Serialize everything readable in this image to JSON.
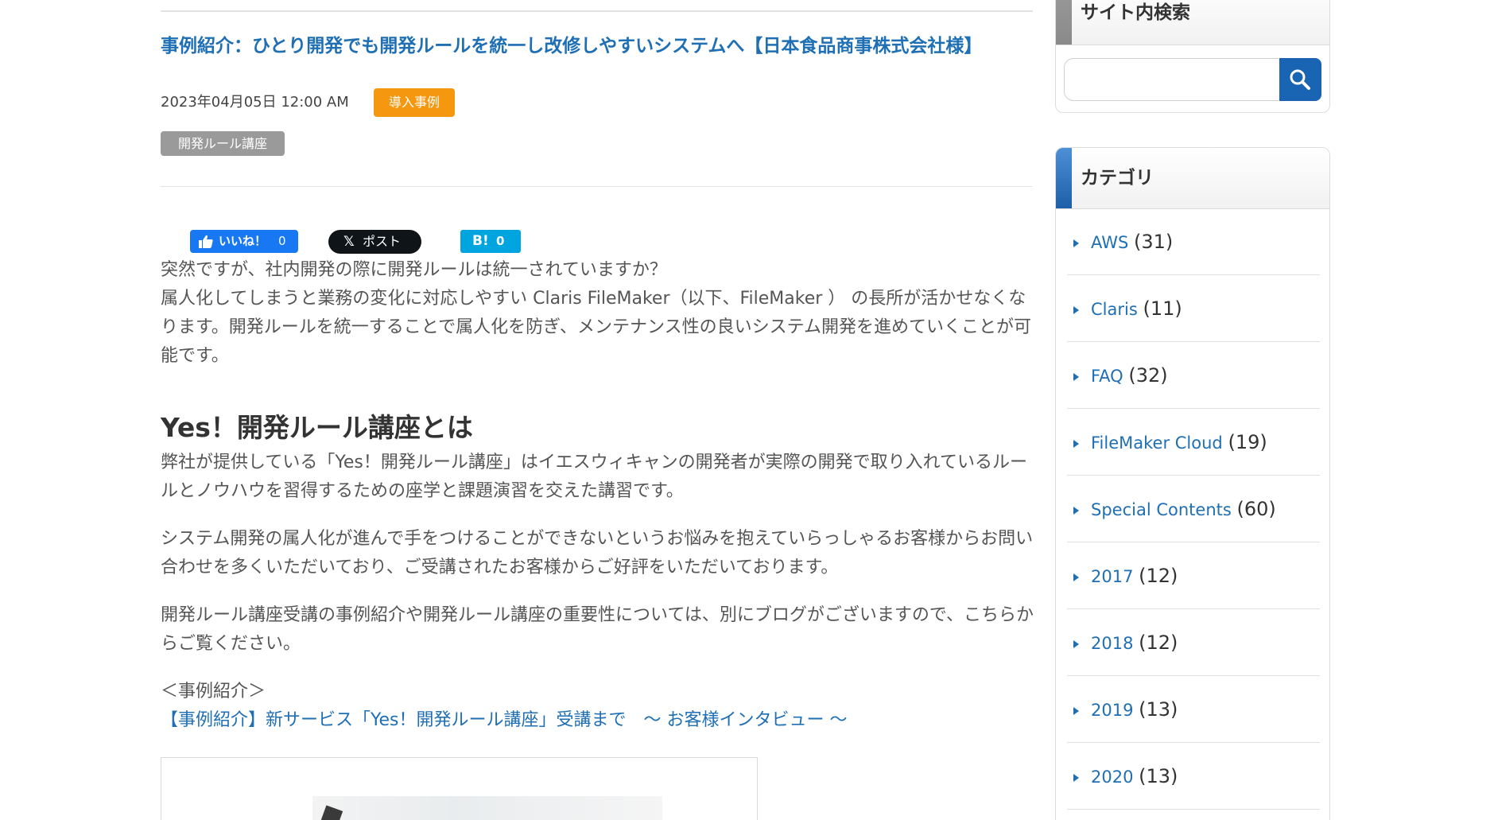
{
  "post": {
    "title": "事例紹介：ひとり開発でも開発ルールを統一し改修しやすいシステムへ【日本食品商事株式会社様】",
    "date": "2023年04月05日 12:00 AM",
    "category": "導入事例",
    "tag": "開発ルール講座"
  },
  "social": {
    "fb_label": "いいね！",
    "fb_count": "0",
    "x_mark": "𝕏",
    "x_label": "ポスト",
    "hatena_mark": "B!",
    "hatena_count": "0"
  },
  "content": {
    "intro_line1": "突然ですが、社内開発の際に開発ルールは統一されていますか？",
    "intro_line2": "属人化してしまうと業務の変化に対応しやすい Claris FileMaker（以下、FileMaker ） の長所が活かせなくなります。開発ルールを統一することで属人化を防ぎ、メンテナンス性の良いシステム開発を進めていくことが可能です。",
    "section_heading": "Yes！開発ルール講座とは",
    "para1": "弊社が提供している「Yes！開発ルール講座」はイエスウィキャンの開発者が実際の開発で取り入れているルールとノウハウを習得するための座学と課題演習を交えた講習です。",
    "para2": "システム開発の属人化が進んで手をつけることができないというお悩みを抱えていらっしゃるお客様からお問い合わせを多くいただいており、ご受講されたお客様からご好評をいただいております。",
    "para3": "開発ルール講座受講の事例紹介や開発ルール講座の重要性については、別にブログがございますので、こちらからご覧ください。",
    "case_label": "＜事例紹介＞",
    "case_link": "【事例紹介】新サービス「Yes！開発ルール講座」受講まで　～ お客様インタビュー ～"
  },
  "sidebar": {
    "search_title": "サイト内検索",
    "search_value": "",
    "search_icon": "search-icon",
    "category_title": "カテゴリ",
    "categories": [
      {
        "label": "AWS",
        "count": "(31)"
      },
      {
        "label": "Claris",
        "count": "(11)"
      },
      {
        "label": "FAQ",
        "count": "(32)"
      },
      {
        "label": "FileMaker Cloud",
        "count": "(19)"
      },
      {
        "label": "Special Contents",
        "count": "(60)"
      },
      {
        "label": "2017",
        "count": "(12)"
      },
      {
        "label": "2018",
        "count": "(12)"
      },
      {
        "label": "2019",
        "count": "(13)"
      },
      {
        "label": "2020",
        "count": "(13)"
      }
    ]
  },
  "colors": {
    "link": "#1f6fb5",
    "category_badge": "#f5970f",
    "tag_badge": "#9a9a9a",
    "facebook": "#1877f2",
    "x": "#0f1419",
    "hatena": "#00a4de",
    "search_button": "#1a64b4"
  }
}
